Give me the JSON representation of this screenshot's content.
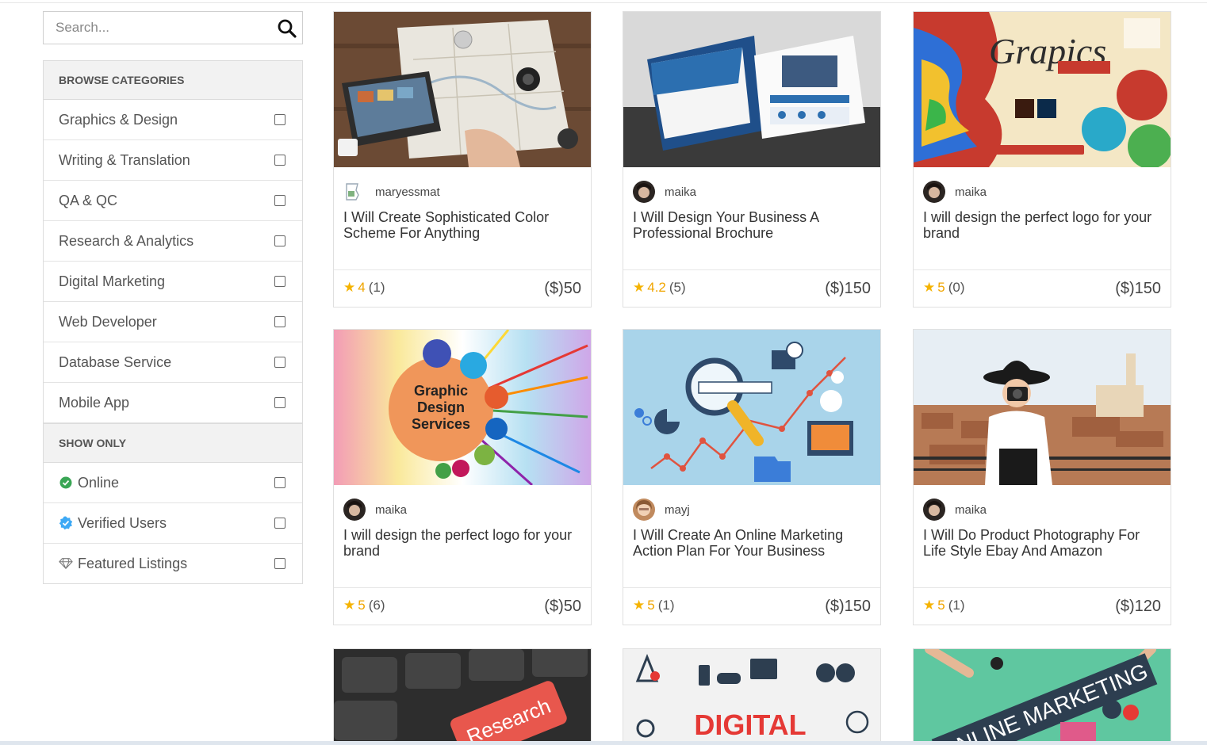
{
  "search": {
    "placeholder": "Search..."
  },
  "browse": {
    "heading": "BROWSE CATEGORIES",
    "items": [
      {
        "label": "Graphics & Design"
      },
      {
        "label": "Writing & Translation"
      },
      {
        "label": "QA & QC"
      },
      {
        "label": "Research & Analytics"
      },
      {
        "label": "Digital Marketing"
      },
      {
        "label": "Web Developer"
      },
      {
        "label": "Database Service"
      },
      {
        "label": "Mobile App"
      }
    ]
  },
  "show_only": {
    "heading": "SHOW ONLY",
    "items": [
      {
        "label": "Online",
        "icon": "online-check-icon",
        "color": "#3aa655"
      },
      {
        "label": "Verified Users",
        "icon": "verified-badge-icon",
        "color": "#3da9f5"
      },
      {
        "label": "Featured Listings",
        "icon": "diamond-icon",
        "color": "#777777"
      }
    ]
  },
  "colors": {
    "star": "#f5b301",
    "rating_score": "#f0a500"
  },
  "cards": [
    {
      "image_text": "",
      "seller": "maryessmat",
      "title": "I Will Create Sophisticated Color Scheme For Anything",
      "score": "4",
      "count": "(1)",
      "price": "($)50"
    },
    {
      "image_text": "",
      "seller": "maika",
      "title": "I Will Design Your Business A Professional Brochure",
      "score": "4.2",
      "count": "(5)",
      "price": "($)150"
    },
    {
      "image_text": "Grapics",
      "seller": "maika",
      "title": "I will design the perfect logo for your brand",
      "score": "5",
      "count": "(0)",
      "price": "($)150"
    },
    {
      "image_text": "Graphic Design Services",
      "seller": "maika",
      "title": "I will design the perfect logo for your brand",
      "score": "5",
      "count": "(6)",
      "price": "($)50"
    },
    {
      "image_text": "",
      "seller": "mayj",
      "title": "I Will Create An Online Marketing Action Plan For Your Business",
      "score": "5",
      "count": "(1)",
      "price": "($)150"
    },
    {
      "image_text": "",
      "seller": "maika",
      "title": "I Will Do Product Photography For Life Style Ebay And Amazon",
      "score": "5",
      "count": "(1)",
      "price": "($)120"
    }
  ],
  "bottom_images": [
    {
      "text": "Research"
    },
    {
      "text": "DIGITAL"
    },
    {
      "text": "ONLINE MARKETING"
    }
  ]
}
